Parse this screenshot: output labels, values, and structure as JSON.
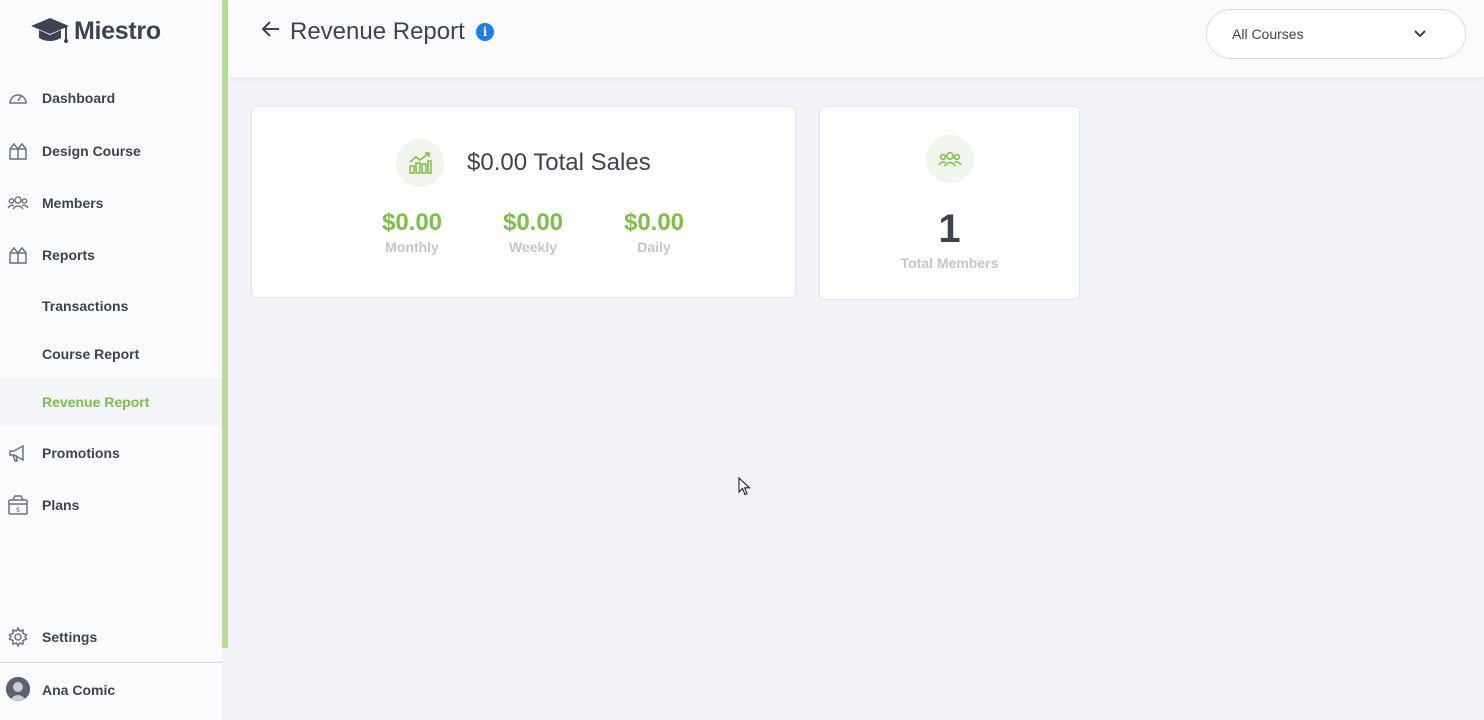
{
  "brand": {
    "name": "Miestro"
  },
  "sidebar": {
    "items": [
      {
        "id": "dashboard",
        "label": "Dashboard",
        "icon": "speedometer-icon"
      },
      {
        "id": "design-course",
        "label": "Design Course",
        "icon": "open-box-icon"
      },
      {
        "id": "members",
        "label": "Members",
        "icon": "users-group-icon"
      },
      {
        "id": "reports",
        "label": "Reports",
        "icon": "open-box-icon"
      },
      {
        "id": "transactions",
        "label": "Transactions"
      },
      {
        "id": "course-report",
        "label": "Course Report"
      },
      {
        "id": "revenue-report",
        "label": "Revenue Report",
        "active": true
      },
      {
        "id": "promotions",
        "label": "Promotions",
        "icon": "megaphone-icon"
      },
      {
        "id": "plans",
        "label": "Plans",
        "icon": "dollar-box-icon"
      }
    ],
    "settings_label": "Settings",
    "profile_name": "Ana Comic"
  },
  "header": {
    "title": "Revenue Report",
    "info_glyph": "i",
    "course_filter": "All Courses"
  },
  "sales_card": {
    "total": "$0.00 Total Sales",
    "stats": [
      {
        "amount": "$0.00",
        "period": "Monthly"
      },
      {
        "amount": "$0.00",
        "period": "Weekly"
      },
      {
        "amount": "$0.00",
        "period": "Daily"
      }
    ]
  },
  "members_card": {
    "count": "1",
    "label": "Total Members"
  },
  "colors": {
    "accent_green": "#7cbf4a",
    "info_blue": "#1e7bf0",
    "text_dark": "#3d4350",
    "text_muted": "#c3c6cc"
  }
}
